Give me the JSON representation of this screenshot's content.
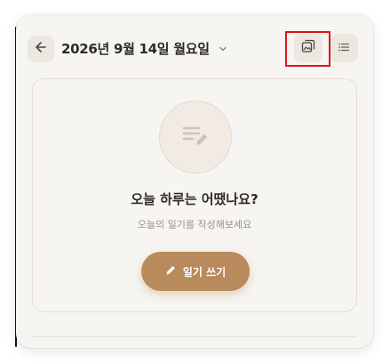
{
  "header": {
    "date_title": "2026년 9월 14일 월요일",
    "back_icon": "arrow-left-icon",
    "date_dropdown_icon": "chevron-down-icon",
    "view_buttons": [
      {
        "name": "gallery-view",
        "icon": "image-gallery-icon",
        "selected": true
      },
      {
        "name": "list-view",
        "icon": "list-icon",
        "selected": false
      }
    ]
  },
  "empty_state": {
    "icon": "edit-note-icon",
    "title": "오늘 하루는 어땠나요?",
    "subtitle": "오늘의 일기를 작성해보세요",
    "write_button_label": "일기 쓰기",
    "write_button_icon": "pencil-icon"
  },
  "colors": {
    "background": "#f7f5f1",
    "accent": "#b88a5c",
    "text_primary": "#2e2a25",
    "text_secondary": "#9b918a",
    "highlight": "#e0141a"
  }
}
